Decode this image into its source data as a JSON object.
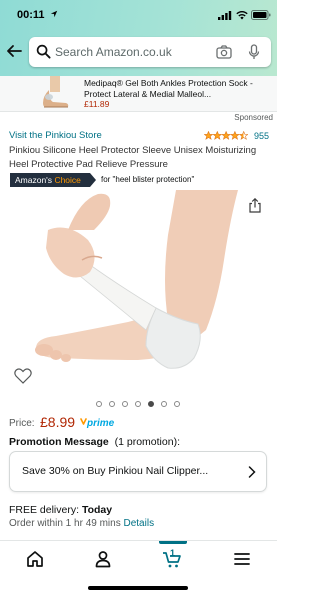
{
  "status_bar": {
    "time": "00:11"
  },
  "search": {
    "placeholder": "Search Amazon.co.uk"
  },
  "sponsored_ad": {
    "title": "Medipaq® Gel Both Ankles Protection Sock - Protect Lateral & Medial Malleol...",
    "price": "£11.89",
    "label": "Sponsored"
  },
  "product": {
    "store_link": "Visit the Pinkiou Store",
    "rating_stars": 4.5,
    "rating_count": "955",
    "title": "Pinkiou Silicone Heel Protector Sleeve Unisex Moisturizing Heel Protective Pad Relieve Pressure",
    "badge_prefix": "Amazon's",
    "badge_choice": "Choice",
    "badge_for": "for \"heel blister protection\"",
    "image_count": 7,
    "image_active_index": 4,
    "price_label": "Price:",
    "price": "£8.99",
    "prime": "prime"
  },
  "promotion": {
    "heading": "Promotion Message",
    "count": "(1 promotion):",
    "text": "Save 30% on Buy Pinkiou Nail Clipper..."
  },
  "delivery": {
    "prefix": "FREE delivery:",
    "day": "Today",
    "order_within": "Order within 1 hr 49 mins",
    "details_link": "Details"
  },
  "tab_bar": {
    "cart_count": "1",
    "active_tab": "cart"
  },
  "colors": {
    "link": "#007185",
    "price": "#b12704",
    "badge_bg": "#232f3e",
    "badge_accent": "#ff9900",
    "header_gradient_start": "#8fdbd5",
    "header_gradient_end": "#b9e8d0"
  }
}
